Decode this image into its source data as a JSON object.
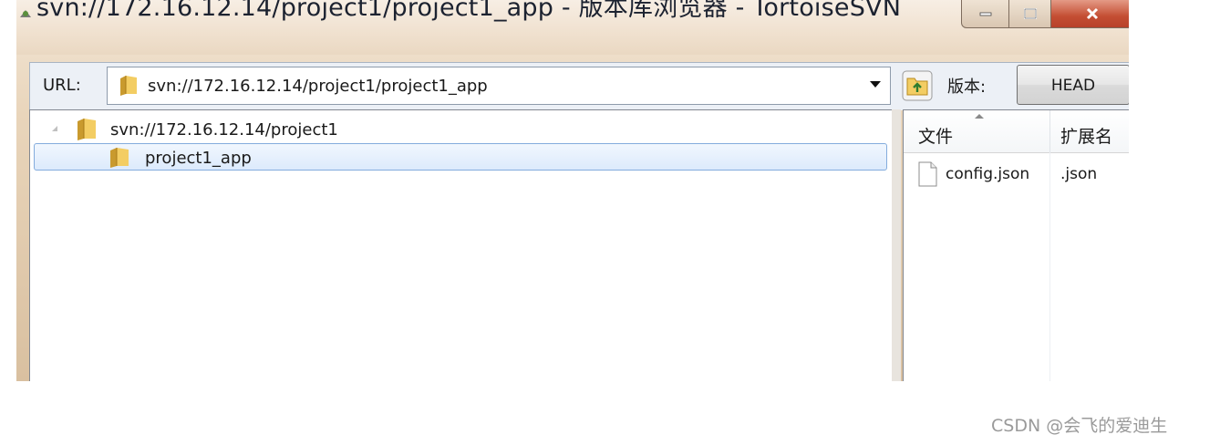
{
  "window": {
    "title": "svn://172.16.12.14/project1/project1_app - 版本库浏览器 - TortoiseSVN"
  },
  "toolbar": {
    "url_label": "URL:",
    "url_value": "svn://172.16.12.14/project1/project1_app",
    "revision_label": "版本:",
    "revision_button": "HEAD"
  },
  "tree": {
    "root": {
      "label": "svn://172.16.12.14/project1",
      "icon": "folder-icon",
      "expanded": true
    },
    "children": [
      {
        "label": "project1_app",
        "icon": "folder-icon",
        "selected": true
      }
    ]
  },
  "file_list": {
    "columns": [
      {
        "label": "文件",
        "sorted": "ascending"
      },
      {
        "label": "扩展名"
      }
    ],
    "rows": [
      {
        "name": "config.json",
        "extension": ".json",
        "icon": "file-icon"
      }
    ]
  },
  "watermark": "CSDN @会飞的爱迪生",
  "colors": {
    "selection_border": "#84acdd",
    "selection_fill": "#dceafc",
    "close_button": "#c44e33",
    "toolbar_background": "#ecf0f6"
  }
}
